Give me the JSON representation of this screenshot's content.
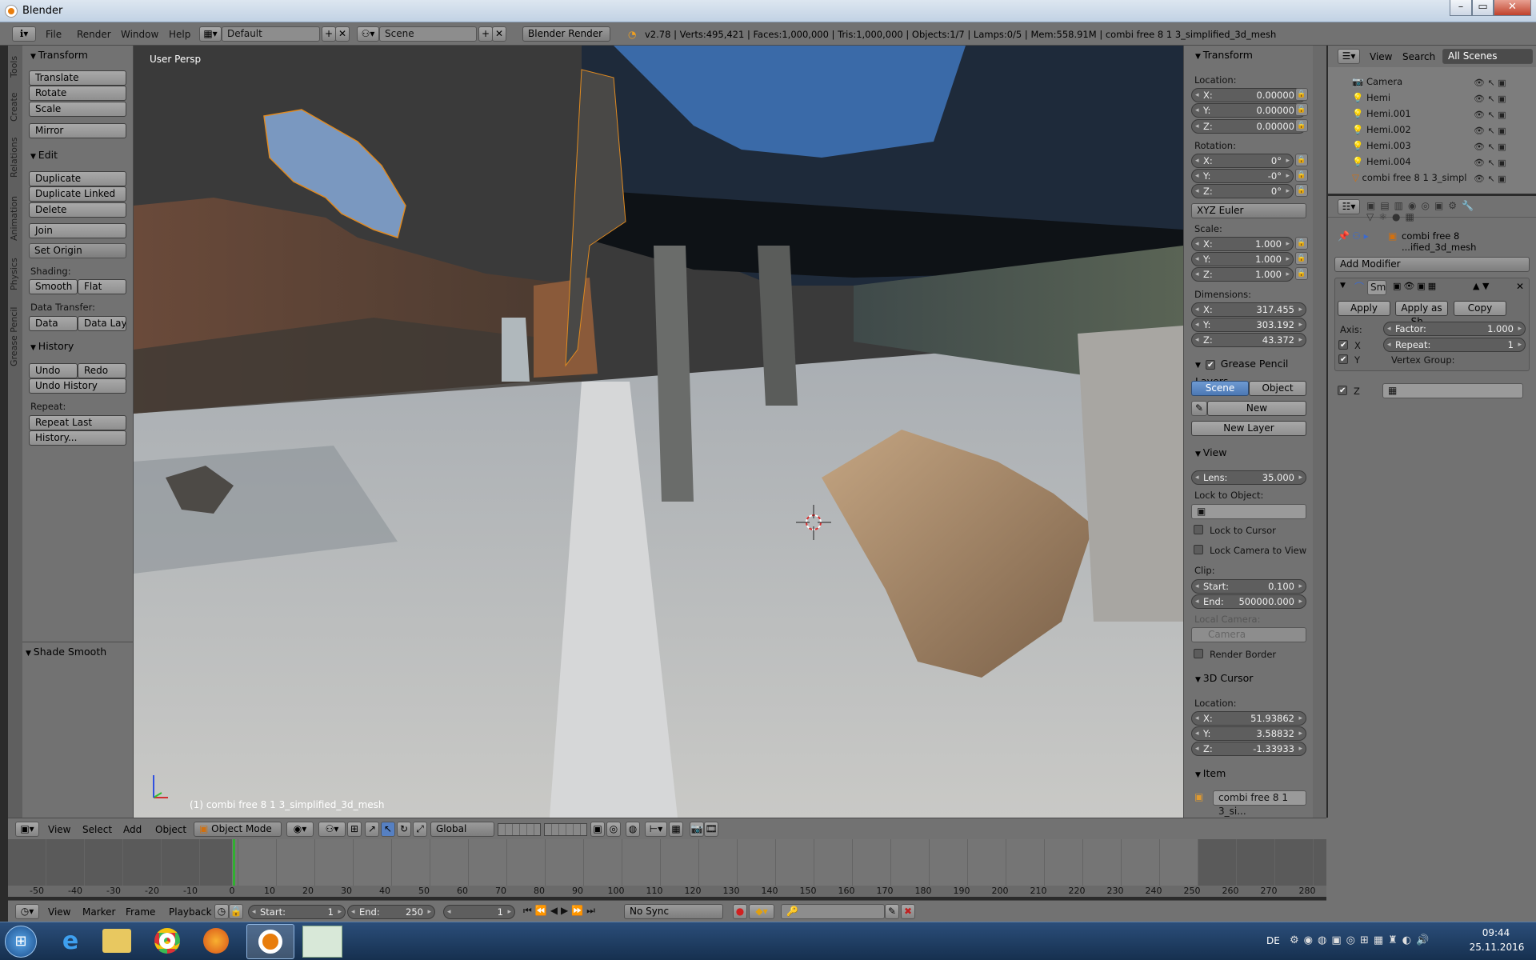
{
  "window": {
    "title": "Blender",
    "min": "–",
    "max": "▭",
    "close": "✕"
  },
  "info": {
    "menus": [
      "File",
      "Render",
      "Window",
      "Help"
    ],
    "layout": "Default",
    "scene": "Scene",
    "engine": "Blender Render",
    "stats": "v2.78 | Verts:495,421 | Faces:1,000,000 | Tris:1,000,000 | Objects:1/7 | Lamps:0/5 | Mem:558.91M | combi free 8 1 3_simplified_3d_mesh"
  },
  "tool_tabs": [
    "Tools",
    "Create",
    "Relations",
    "Animation",
    "Physics",
    "Grease Pencil"
  ],
  "toolshelf": {
    "transform": {
      "title": "Transform",
      "buttons": [
        "Translate",
        "Rotate",
        "Scale",
        "Mirror"
      ]
    },
    "edit": {
      "title": "Edit",
      "buttons": [
        "Duplicate",
        "Duplicate Linked",
        "Delete",
        "Join"
      ],
      "set_origin": "Set Origin",
      "shading_label": "Shading:",
      "smooth": "Smooth",
      "flat": "Flat",
      "data_transfer_label": "Data Transfer:",
      "data": "Data",
      "data_layo": "Data Layo"
    },
    "history": {
      "title": "History",
      "undo": "Undo",
      "redo": "Redo",
      "undo_history": "Undo History",
      "repeat_label": "Repeat:",
      "repeat_last": "Repeat Last",
      "history_dots": "History..."
    },
    "operator": {
      "title": "Shade Smooth"
    }
  },
  "viewport": {
    "view_name": "User Persp",
    "object_label": "(1) combi free 8 1 3_simplified_3d_mesh"
  },
  "npanel": {
    "transform_title": "Transform",
    "location_label": "Location:",
    "loc": [
      {
        "k": "X:",
        "v": "0.00000"
      },
      {
        "k": "Y:",
        "v": "0.00000"
      },
      {
        "k": "Z:",
        "v": "0.00000"
      }
    ],
    "rotation_label": "Rotation:",
    "rot": [
      {
        "k": "X:",
        "v": "0°"
      },
      {
        "k": "Y:",
        "v": "-0°"
      },
      {
        "k": "Z:",
        "v": "0°"
      }
    ],
    "rot_mode": "XYZ Euler",
    "scale_label": "Scale:",
    "scale": [
      {
        "k": "X:",
        "v": "1.000"
      },
      {
        "k": "Y:",
        "v": "1.000"
      },
      {
        "k": "Z:",
        "v": "1.000"
      }
    ],
    "dimensions_label": "Dimensions:",
    "dim": [
      {
        "k": "X:",
        "v": "317.455"
      },
      {
        "k": "Y:",
        "v": "303.192"
      },
      {
        "k": "Z:",
        "v": "43.372"
      }
    ],
    "gp_title": "Grease Pencil Layers",
    "gp_scene": "Scene",
    "gp_object": "Object",
    "gp_new": "New",
    "gp_new_layer": "New Layer",
    "view_title": "View",
    "lens": {
      "k": "Lens:",
      "v": "35.000"
    },
    "lock_obj_label": "Lock to Object:",
    "lock_cursor": "Lock to Cursor",
    "lock_cam": "Lock Camera to View",
    "clip_label": "Clip:",
    "clip": [
      {
        "k": "Start:",
        "v": "0.100"
      },
      {
        "k": "End:",
        "v": "500000.000"
      }
    ],
    "local_cam_label": "Local Camera:",
    "local_cam": "Camera",
    "render_border": "Render Border",
    "cursor_title": "3D Cursor",
    "cursor_loc_label": "Location:",
    "cursor": [
      {
        "k": "X:",
        "v": "51.93862"
      },
      {
        "k": "Y:",
        "v": "3.58832"
      },
      {
        "k": "Z:",
        "v": "-1.33933"
      }
    ],
    "item_title": "Item",
    "item_name": "combi free 8 1 3_si..."
  },
  "outliner": {
    "view": "View",
    "search": "Search",
    "scenes": "All Scenes",
    "items": [
      "Camera",
      "Hemi",
      "Hemi.001",
      "Hemi.002",
      "Hemi.003",
      "Hemi.004",
      "combi free 8 1 3_simpl"
    ]
  },
  "properties": {
    "object_path": "combi free 8 ...ified_3d_mesh",
    "add_modifier": "Add Modifier",
    "mod_name": "Sm",
    "apply": "Apply",
    "apply_as": "Apply as Sh...",
    "copy": "Copy",
    "axis_label": "Axis:",
    "x": "X",
    "y": "Y",
    "z": "Z",
    "factor": {
      "k": "Factor:",
      "v": "1.000"
    },
    "repeat": {
      "k": "Repeat:",
      "v": "1"
    },
    "vgroup": "Vertex Group:"
  },
  "view3d_header": {
    "menus": [
      "View",
      "Select",
      "Add",
      "Object"
    ],
    "mode": "Object Mode",
    "orientation": "Global"
  },
  "timeline": {
    "ticks": [
      "-50",
      "-40",
      "-30",
      "-20",
      "-10",
      "0",
      "10",
      "20",
      "30",
      "40",
      "50",
      "60",
      "70",
      "80",
      "90",
      "100",
      "110",
      "120",
      "130",
      "140",
      "150",
      "160",
      "170",
      "180",
      "190",
      "200",
      "210",
      "220",
      "230",
      "240",
      "250",
      "260",
      "270",
      "280"
    ],
    "menus": [
      "View",
      "Marker",
      "Frame",
      "Playback"
    ],
    "start": {
      "k": "Start:",
      "v": "1"
    },
    "end": {
      "k": "End:",
      "v": "250"
    },
    "current": "1",
    "sync": "No Sync"
  },
  "taskbar": {
    "lang": "DE",
    "time": "09:44",
    "date": "25.11.2016"
  }
}
